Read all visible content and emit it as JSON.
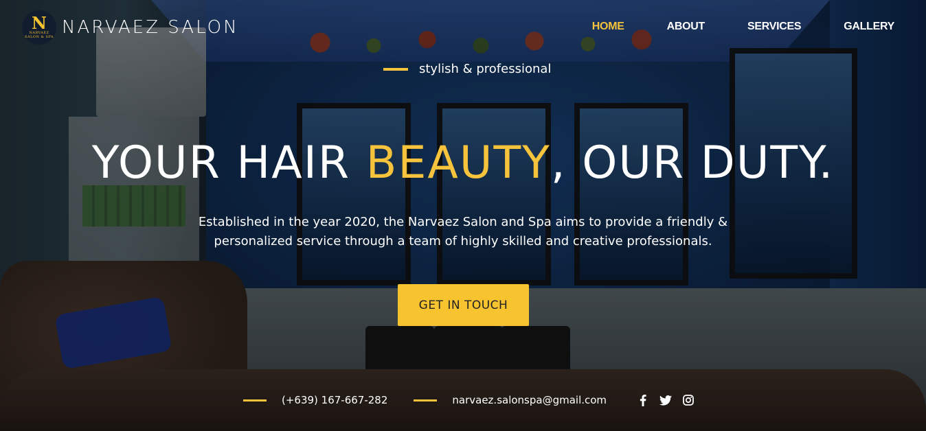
{
  "brand": {
    "name": "NARVAEZ SALON",
    "logo_letter": "N",
    "logo_sub": "NARVAEZ",
    "logo_sub2": "SALON & SPA",
    "accent": "#f5c33c"
  },
  "nav": {
    "items": [
      {
        "label": "HOME",
        "active": true
      },
      {
        "label": "ABOUT",
        "active": false
      },
      {
        "label": "SERVICES",
        "active": false
      },
      {
        "label": "GALLERY",
        "active": false
      }
    ]
  },
  "hero": {
    "tagline": "stylish & professional",
    "headline_part1": "YOUR HAIR ",
    "headline_highlight": "BEAUTY",
    "headline_part2": ", OUR DUTY.",
    "description": "Established in the year 2020, the Narvaez Salon and Spa aims to provide a friendly & personalized service through a team of highly skilled and creative professionals.",
    "cta_label": "GET IN TOUCH"
  },
  "contact": {
    "phone": "(+639) 167-667-282",
    "email": "narvaez.salonspa@gmail.com"
  },
  "social": {
    "icons": [
      "facebook-icon",
      "twitter-icon",
      "instagram-icon"
    ]
  }
}
